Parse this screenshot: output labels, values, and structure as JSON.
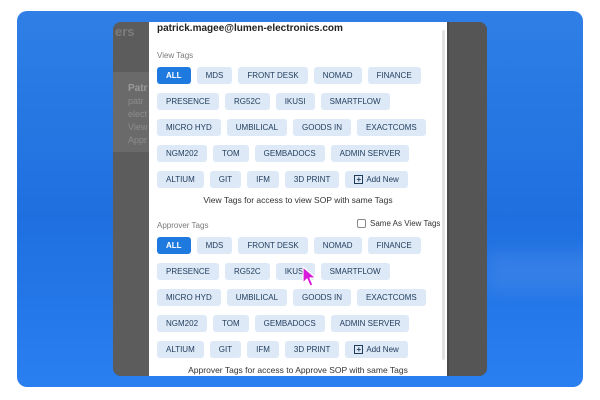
{
  "email": "patrick.magee@lumen-electronics.com",
  "background_app": {
    "tab_fragment": "ers",
    "card_name": "Patr",
    "card_lines": [
      "patr",
      "elect",
      "View",
      "Appr"
    ]
  },
  "view_tags": {
    "label": "View Tags",
    "rows": [
      [
        {
          "text": "ALL",
          "active": true
        },
        {
          "text": "MDS"
        },
        {
          "text": "FRONT DESK"
        },
        {
          "text": "NOMAD"
        },
        {
          "text": "FINANCE"
        }
      ],
      [
        {
          "text": "PRESENCE"
        },
        {
          "text": "RG52C"
        },
        {
          "text": "IKUSI"
        },
        {
          "text": "SMARTFLOW"
        }
      ],
      [
        {
          "text": "MICRO HYD"
        },
        {
          "text": "UMBILICAL"
        },
        {
          "text": "GOODS IN"
        },
        {
          "text": "EXACTCOMS"
        }
      ],
      [
        {
          "text": "NGM202"
        },
        {
          "text": "TOM"
        },
        {
          "text": "GEMBADOCS"
        },
        {
          "text": "ADMIN SERVER"
        }
      ],
      [
        {
          "text": "ALTIUM"
        },
        {
          "text": "GIT"
        },
        {
          "text": "IFM"
        },
        {
          "text": "3D PRINT"
        },
        {
          "text": "Add New",
          "add": true
        }
      ]
    ],
    "hint": "View Tags for access to view SOP with same Tags"
  },
  "approver_tags": {
    "label": "Approver Tags",
    "same_as_label": "Same As View Tags",
    "same_as_checked": false,
    "rows": [
      [
        {
          "text": "ALL",
          "active": true
        },
        {
          "text": "MDS"
        },
        {
          "text": "FRONT DESK"
        },
        {
          "text": "NOMAD"
        },
        {
          "text": "FINANCE"
        }
      ],
      [
        {
          "text": "PRESENCE"
        },
        {
          "text": "RG52C"
        },
        {
          "text": "IKUSI"
        },
        {
          "text": "SMARTFLOW"
        }
      ],
      [
        {
          "text": "MICRO HYD"
        },
        {
          "text": "UMBILICAL"
        },
        {
          "text": "GOODS IN"
        },
        {
          "text": "EXACTCOMS"
        }
      ],
      [
        {
          "text": "NGM202"
        },
        {
          "text": "TOM"
        },
        {
          "text": "GEMBADOCS"
        },
        {
          "text": "ADMIN SERVER"
        }
      ],
      [
        {
          "text": "ALTIUM"
        },
        {
          "text": "GIT"
        },
        {
          "text": "IFM"
        },
        {
          "text": "3D PRINT"
        },
        {
          "text": "Add New",
          "add": true
        }
      ]
    ],
    "hint": "Approver Tags for access to Approve SOP with same Tags"
  },
  "colors": {
    "accent": "#1f7ae0",
    "tag_bg": "#dde9f7",
    "frame": "#1f6fe0",
    "cursor": "#d81bd8"
  },
  "cursor_icon": "arrow-pointer-icon"
}
